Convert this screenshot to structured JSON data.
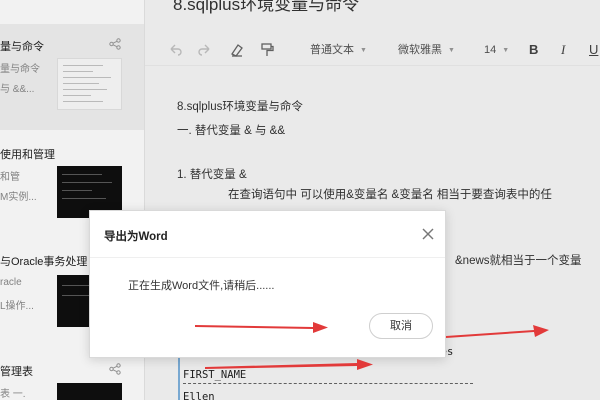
{
  "sidebar": {
    "notes": [
      {
        "title": "量与命令",
        "line1": "量与命令",
        "line2": "与 &&..."
      },
      {
        "title": "使用和管理",
        "line1": "和管",
        "line2": "M实例..."
      },
      {
        "title": "与Oracle事务处理",
        "line1": "racle",
        "line2": "L操作..."
      },
      {
        "title": "管理表",
        "line1": "表 一.",
        "line2": ""
      }
    ]
  },
  "editor": {
    "doc_title": "8.sqlplus环境变量与命令",
    "toolbar": {
      "paragraph_style": "普通文本",
      "font_family": "微软雅黑",
      "font_size": "14",
      "bold": "B",
      "italic": "I",
      "underline": "U"
    },
    "content": {
      "heading": "8.sqlplus环境变量与命令",
      "section": "一. 替代变量  &    与  &&",
      "item": "1. 替代变量  &",
      "paragraph": "在查询语句中  可以使用&变量名  &变量名 相当于要查询表中的任",
      "partial_line": "&news就相当于一个变量",
      "sql_partial": "yees",
      "sql_column": "FIRST_NAME",
      "sql_value": "Ellen"
    }
  },
  "dialog": {
    "title": "导出为Word",
    "message": "正在生成Word文件,请稍后......",
    "cancel_label": "取消"
  },
  "colors": {
    "arrow": "#e23a3a",
    "cancel_border": "#cfcfcf"
  },
  "icons": [
    "share-icon",
    "undo-icon",
    "redo-icon",
    "eraser-icon",
    "format-painter-icon",
    "dropdown-caret-icon",
    "close-icon",
    "red-arrow"
  ]
}
